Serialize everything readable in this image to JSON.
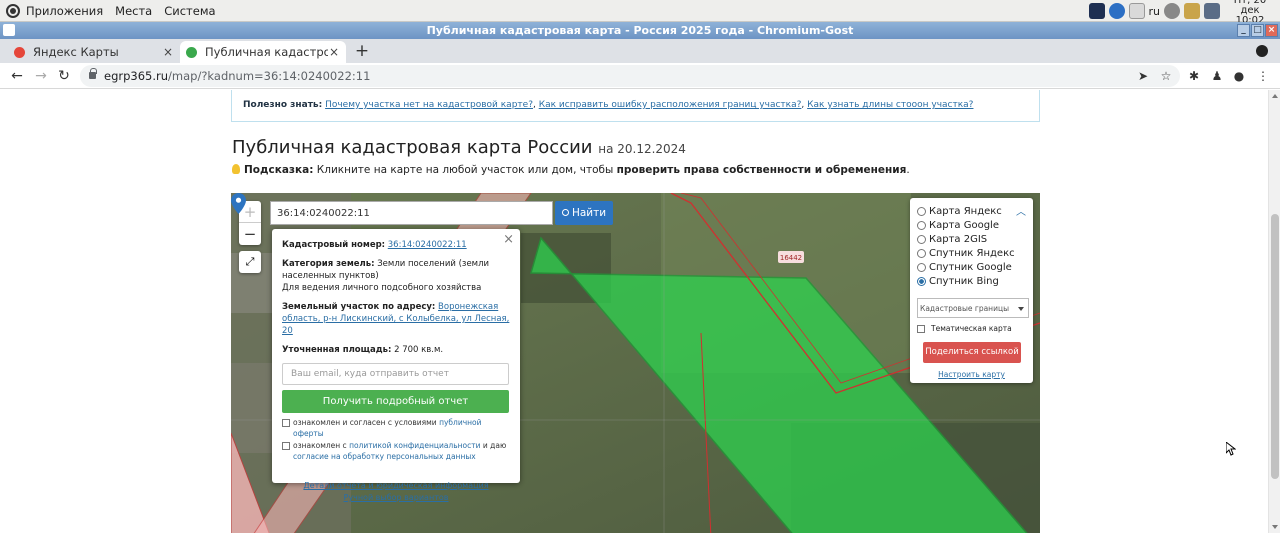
{
  "panel": {
    "menu": [
      "Приложения",
      "Места",
      "Система"
    ],
    "lang": "ru",
    "clock_line1": "Пт, 20 дек",
    "clock_line2": "10:02"
  },
  "window": {
    "title": "Публичная кадастровая карта - Россия 2025 года - Chromium-Gost"
  },
  "tabs": [
    {
      "label": "Яндекс Карты",
      "icon_color": "#e5463a"
    },
    {
      "label": "Публичная кадастровая к",
      "icon_color": "#3aa84c"
    }
  ],
  "address": {
    "domain": "egrp365.ru",
    "path": "/map/?kadnum=36:14:0240022:11"
  },
  "infobar": {
    "prefix": "Полезно знать:",
    "links": [
      "Почему участка нет на кадастровой карте?",
      "Как исправить ошибку расположения границ участка?",
      "Как узнать длины стоoон участка?"
    ]
  },
  "heading": {
    "title": "Публичная кадастровая карта России",
    "date": "на 20.12.2024"
  },
  "hint": {
    "label": "Подсказка:",
    "text": "Кликните на карте на любой участок или дом, чтобы",
    "bold": "проверить права собственности и обременения",
    "end": "."
  },
  "map": {
    "zoom_in": "+",
    "zoom_out": "−",
    "search_value": "36:14:0240022:11",
    "find_label": "Найти",
    "parcel_label": "16442"
  },
  "popup": {
    "kadnum_label": "Кадастровый номер:",
    "kadnum_value": "36:14:0240022:11",
    "category_label": "Категория земель:",
    "category_value": "Земли поселений (земли населенных пунктов)",
    "use_value": "Для ведения личного подсобного хозяйства",
    "address_label": "Земельный участок по адресу:",
    "address_value": "Воронежская область, р-н Лискинский, с Колыбелка, ул Лесная, 20",
    "area_label": "Уточненная площадь:",
    "area_value": "2 700 кв.м.",
    "email_placeholder": "Ваш email, куда отправить отчет",
    "get_report": "Получить подробный отчет",
    "agree1_text": "ознакомлен и согласен с условиями",
    "agree1_link": "публичной оферты",
    "agree2_text": "ознакомлен с",
    "agree2_link": "политикой конфиденциальности",
    "agree2_text2": "и даю",
    "agree2_link2": "согласие на обработку персональных данных",
    "details_link": "Детали отчета и юридическая информация",
    "manual_link": "Ручной выбор вариантов"
  },
  "layers": {
    "options": [
      {
        "label": "Карта Яндекс",
        "selected": false
      },
      {
        "label": "Карта Google",
        "selected": false
      },
      {
        "label": "Карта 2GIS",
        "selected": false
      },
      {
        "label": "Спутник Яндекс",
        "selected": false
      },
      {
        "label": "Спутник Google",
        "selected": false
      },
      {
        "label": "Спутник Bing",
        "selected": true
      }
    ],
    "select_value": "Кадастровые границы",
    "thematic": "Тематическая карта",
    "share": "Поделиться ссылкой",
    "configure": "Настроить карту"
  }
}
